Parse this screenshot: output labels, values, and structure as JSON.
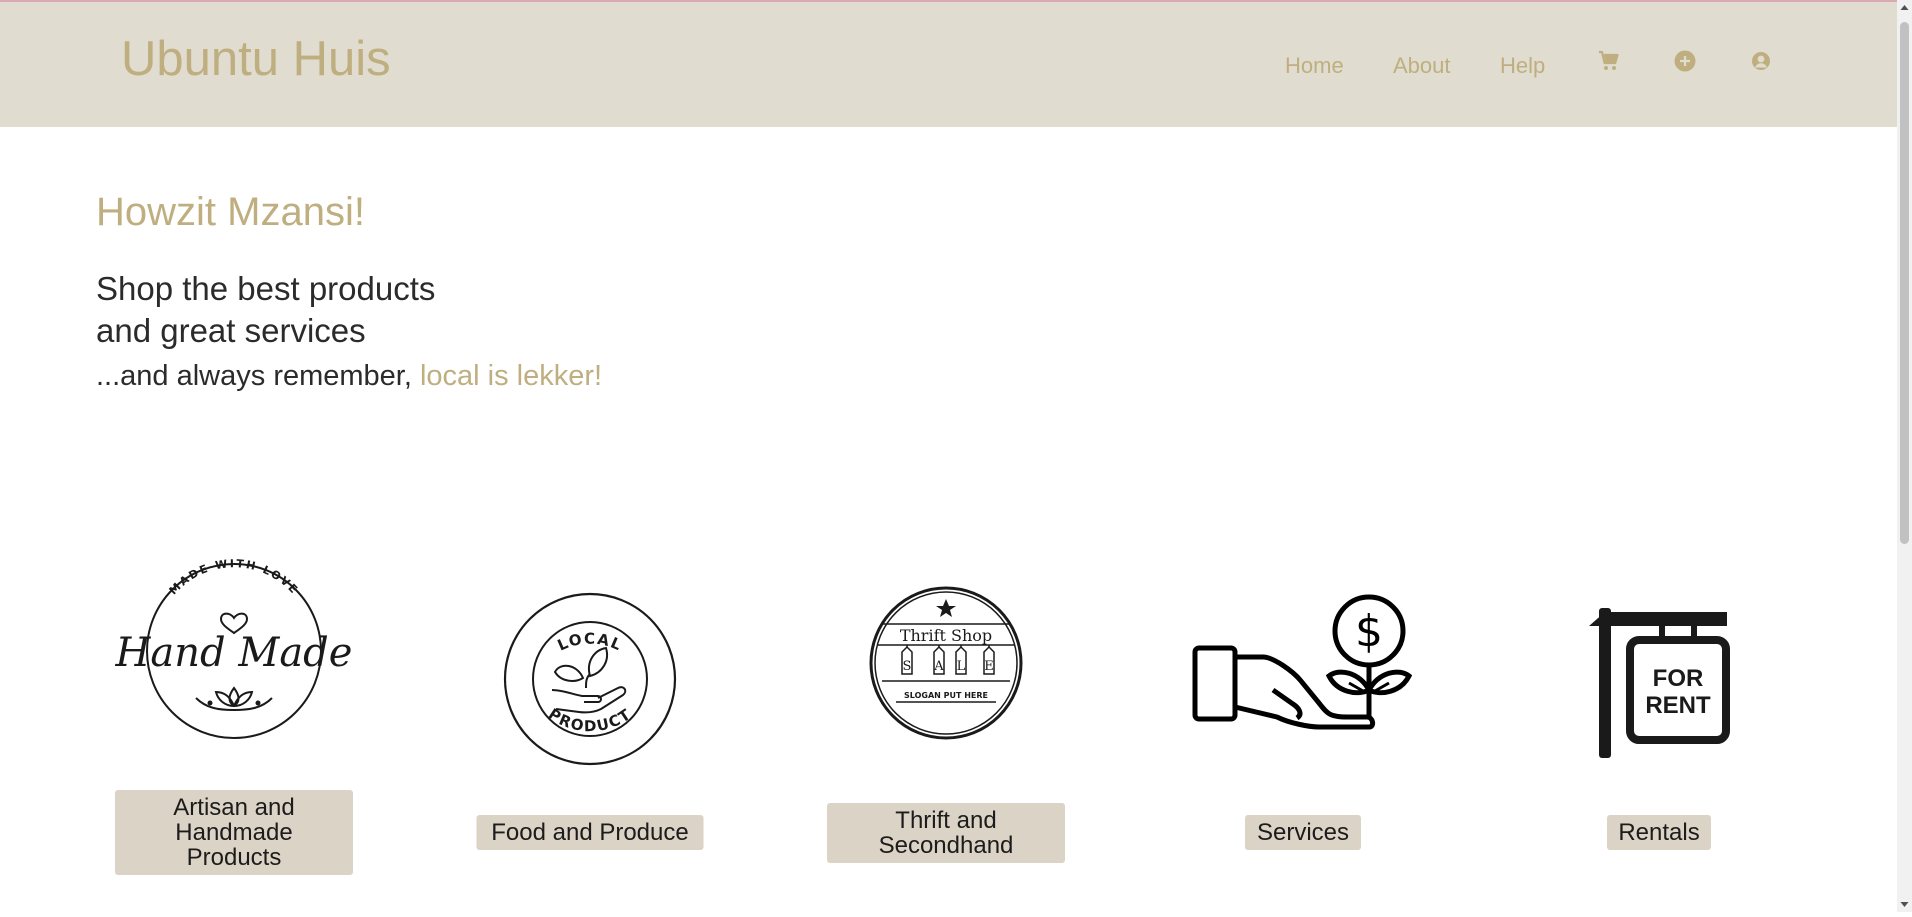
{
  "header": {
    "brand": "Ubuntu Huis",
    "nav": [
      {
        "label": "Home"
      },
      {
        "label": "About"
      },
      {
        "label": "Help"
      }
    ],
    "icons": [
      "cart-icon",
      "plus-circle-icon",
      "user-circle-icon"
    ]
  },
  "hero": {
    "greeting": "Howzit Mzansi!",
    "lead_line1": "Shop the best products",
    "lead_line2": "and great services",
    "sub_prefix": "...and always remember, ",
    "sub_accent": "local is lekker!"
  },
  "logos": {
    "handmade_top": "MADE WITH LOVE",
    "handmade_script": "Hand Made",
    "local_top": "LOCAL",
    "local_bottom": "PRODUCT",
    "thrift_title": "Thrift Shop",
    "thrift_tags": [
      "S",
      "A",
      "L",
      "E"
    ],
    "thrift_slogan": "SLOGAN PUT HERE",
    "rent_line1": "FOR",
    "rent_line2": "RENT"
  },
  "categories": [
    {
      "label": "Artisan and Handmade Products"
    },
    {
      "label": "Food and Produce"
    },
    {
      "label": "Thrift and Secondhand"
    },
    {
      "label": "Services"
    },
    {
      "label": "Rentals"
    }
  ],
  "colors": {
    "accent": "#bfaf80",
    "header_bg": "#e0dccf",
    "label_bg": "#dbd3c5"
  }
}
